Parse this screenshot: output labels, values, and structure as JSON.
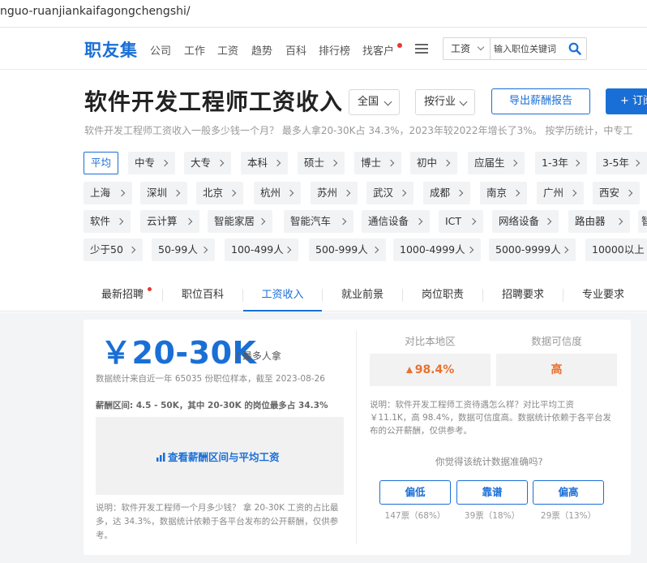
{
  "url": "nguo-ruanjiankaifagongchengshi/",
  "nav": {
    "logo": "职友集",
    "items": [
      "公司",
      "工作",
      "工资",
      "趋势",
      "百科",
      "排行榜",
      "找客户"
    ],
    "search": {
      "select": "工资",
      "placeholder": "输入职位关键词"
    }
  },
  "header": {
    "title": "软件开发工程师工资收入",
    "region_select": "全国",
    "industry_select": "按行业",
    "export_button": "导出薪酬报告",
    "subscribe_button": "+ 订阅",
    "subtitle": "软件开发工程师工资收入一般多少钱一个月？ 最多人拿20-30K占 34.3%，2023年较2022年增长了3%。 按学历统计，中专工"
  },
  "filters": {
    "education": [
      "平均",
      "中专",
      "大专",
      "本科",
      "硕士",
      "博士",
      "初中",
      "应届生",
      "1-3年",
      "3-5年"
    ],
    "cities": [
      "上海",
      "深圳",
      "北京",
      "杭州",
      "苏州",
      "武汉",
      "成都",
      "南京",
      "广州",
      "西安"
    ],
    "industries": [
      "软件",
      "云计算",
      "智能家居",
      "智能汽车",
      "通信设备",
      "ICT",
      "网络设备",
      "路由器",
      "智"
    ],
    "company_size": [
      "少于50",
      "50-99人",
      "100-499人",
      "500-999人",
      "1000-4999人",
      "5000-9999人",
      "10000以上"
    ]
  },
  "tabs": [
    "最新招聘",
    "职位百科",
    "工资收入",
    "就业前景",
    "岗位职责",
    "招聘要求",
    "专业要求"
  ],
  "active_tab": "工资收入",
  "salary": {
    "main": "￥20-30K",
    "main_note": "/ 最多人拿",
    "stat_note": "数据统计来自近一年 65035 份职位样本，截至 2023-08-26",
    "range_note": "薪酬区间: 4.5 - 50K，其中 20-30K 的岗位最多占 34.3%",
    "chart_link": "查看薪酬区间与平均工资",
    "description": "说明：软件开发工程师一个月多少钱？ 拿 20-30K 工资的占比最多，达 34.3%，数据统计依赖于各平台发布的公开薪酬，仅供参考。"
  },
  "compare": {
    "region_label": "对比本地区",
    "region_value": "98.4%",
    "confidence_label": "数据可信度",
    "confidence_value": "高",
    "description": "说明：软件开发工程师工资待遇怎么样？对比平均工资 ￥11.1K，高 98.4%，数据可信度高。数据统计依赖于各平台发布的公开薪酬，仅供参考。",
    "question": "你觉得该统计数据准确吗?",
    "votes": [
      {
        "label": "偏低",
        "count": "147票（68%）"
      },
      {
        "label": "靠谱",
        "count": "39票（18%）"
      },
      {
        "label": "偏高",
        "count": "29票（13%）"
      }
    ]
  },
  "colors": {
    "accent": "#1a6fd6",
    "highlight": "#e8712e",
    "notification": "#e53935"
  }
}
